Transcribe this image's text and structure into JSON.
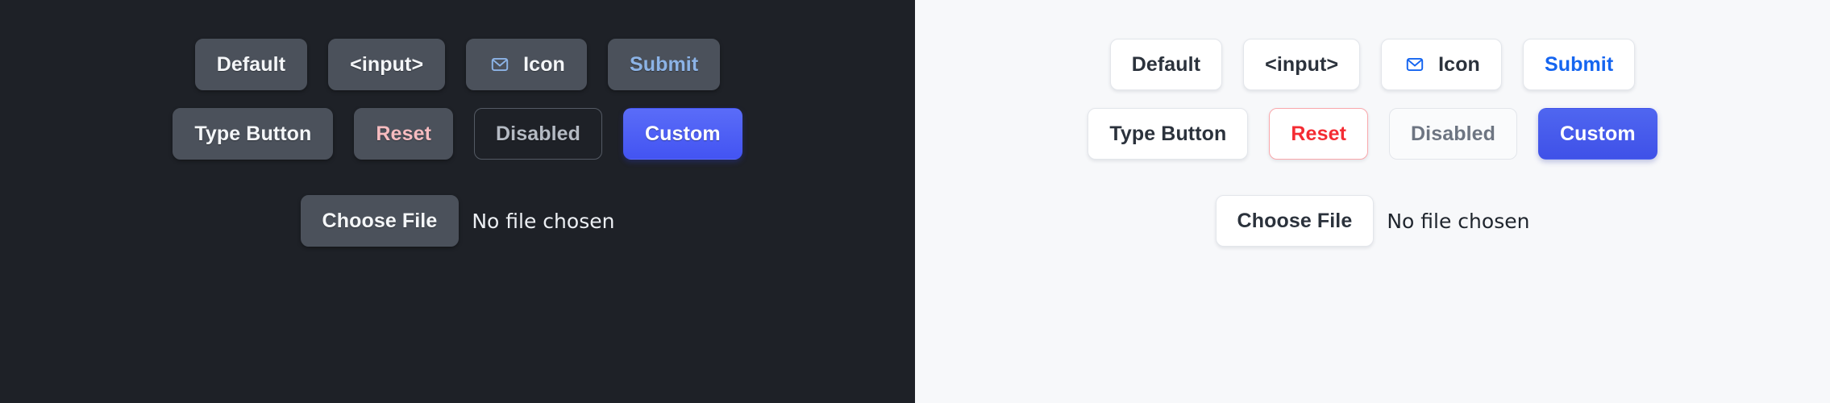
{
  "panels": [
    {
      "theme": "dark",
      "background": "#1e2127",
      "rows": [
        {
          "buttons": [
            {
              "label": "Default",
              "variant": "default",
              "icon": null
            },
            {
              "label": "<input>",
              "variant": "default",
              "icon": null
            },
            {
              "label": "Icon",
              "variant": "default",
              "icon": "mail-icon"
            },
            {
              "label": "Submit",
              "variant": "submit",
              "icon": null
            }
          ]
        },
        {
          "buttons": [
            {
              "label": "Type Button",
              "variant": "default",
              "icon": null
            },
            {
              "label": "Reset",
              "variant": "reset",
              "icon": null
            },
            {
              "label": "Disabled",
              "variant": "disabled",
              "icon": null
            },
            {
              "label": "Custom",
              "variant": "custom",
              "icon": null
            }
          ]
        }
      ],
      "file": {
        "button_label": "Choose File",
        "status": "No file chosen"
      },
      "colors": {
        "surface": "#4b515b",
        "text": "#f4f6f8",
        "submit_text": "#8cb3e6",
        "reset_text": "#f6bcc0",
        "disabled_text": "#b4bac3",
        "disabled_border": "#545a64",
        "custom_from": "#5a6cf8",
        "custom_to": "#4354f2",
        "icon": "#8cb3e6"
      }
    },
    {
      "theme": "light",
      "background": "#f7f8fa",
      "rows": [
        {
          "buttons": [
            {
              "label": "Default",
              "variant": "default",
              "icon": null
            },
            {
              "label": "<input>",
              "variant": "default",
              "icon": null
            },
            {
              "label": "Icon",
              "variant": "default",
              "icon": "mail-icon"
            },
            {
              "label": "Submit",
              "variant": "submit",
              "icon": null
            }
          ]
        },
        {
          "buttons": [
            {
              "label": "Type Button",
              "variant": "default",
              "icon": null
            },
            {
              "label": "Reset",
              "variant": "reset",
              "icon": null
            },
            {
              "label": "Disabled",
              "variant": "disabled",
              "icon": null
            },
            {
              "label": "Custom",
              "variant": "custom",
              "icon": null
            }
          ]
        }
      ],
      "file": {
        "button_label": "Choose File",
        "status": "No file chosen"
      },
      "colors": {
        "surface": "#ffffff",
        "text": "#2b323c",
        "submit_text": "#1565f0",
        "reset_text": "#f42c33",
        "reset_border": "#f9a8ac",
        "disabled_text": "#6d7582",
        "disabled_border": "#e3e6eb",
        "custom_from": "#4f66f0",
        "custom_to": "#3f51e8",
        "icon": "#1565f0"
      }
    }
  ]
}
